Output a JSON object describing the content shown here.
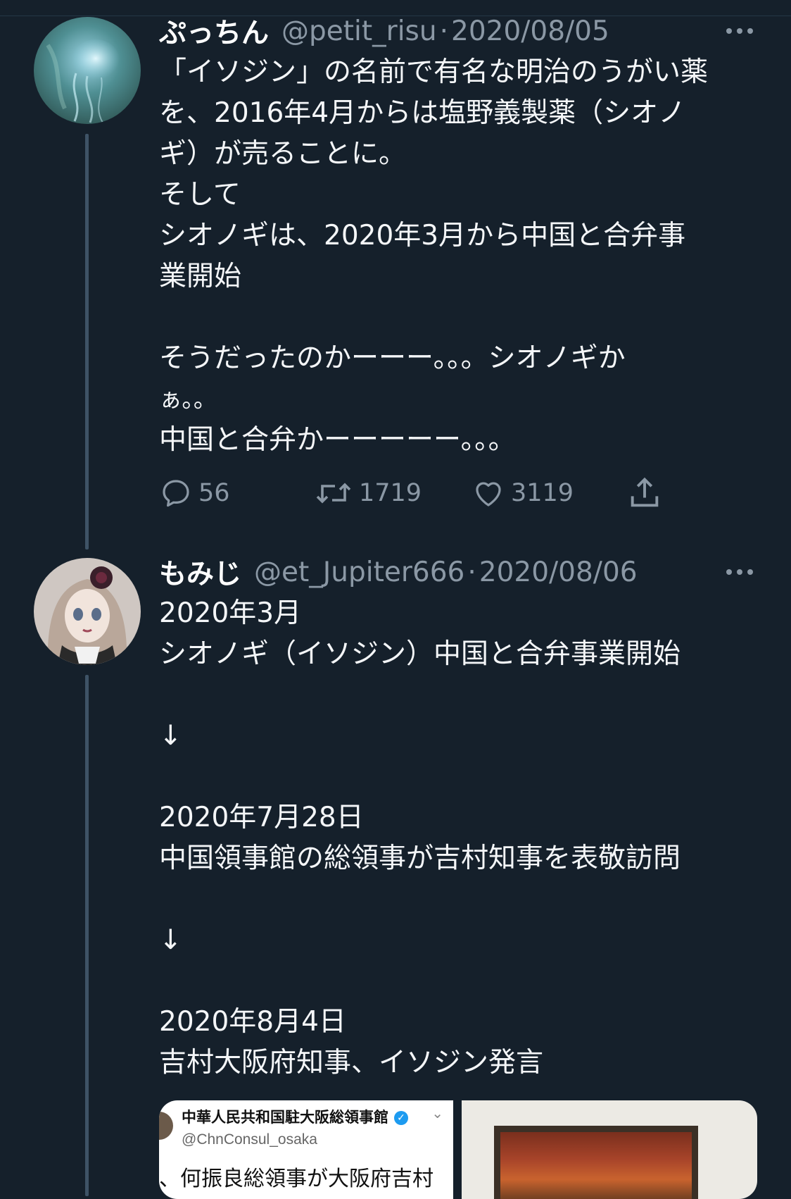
{
  "tweets": [
    {
      "display_name": "ぷっちん",
      "handle": "@petit_risu",
      "separator": "·",
      "date": "2020/08/05",
      "avatar_icon": "jellyfish-avatar-icon",
      "body_lines": [
        "「イソジン」の名前で有名な明治のうがい薬",
        "を、2016年4月からは塩野義製薬（シオノ",
        "ギ）が売ることに。",
        "そして",
        "シオノギは、2020年3月から中国と合弁事",
        "業開始",
        "",
        "そうだったのかーーー。。。シオノギか",
        "ぁ。。",
        "中国と合弁かーーーーー。。。"
      ],
      "actions": {
        "reply_count": "56",
        "retweet_count": "1719",
        "like_count": "3119"
      }
    },
    {
      "display_name": "もみじ",
      "handle": "@et_Jupiter666",
      "separator": "·",
      "date": "2020/08/06",
      "avatar_icon": "doll-avatar-icon",
      "body_lines": [
        "2020年3月",
        "シオノギ（イソジン）中国と合弁事業開始",
        "",
        "↓",
        "",
        "2020年7月28日",
        "中国領事館の総領事が吉村知事を表敬訪問",
        "",
        "↓",
        "",
        "2020年8月4日",
        "吉村大阪府知事、イソジン発言"
      ],
      "media": {
        "embedded_account_name": "中華人民共和国駐大阪総領事館",
        "embedded_handle": "@ChnConsul_osaka",
        "embedded_text": "、何振良総領事が大阪府吉村"
      }
    }
  ],
  "colors": {
    "background": "#15202b",
    "secondary_text": "#8b98a5",
    "thread_line": "#3e5366",
    "verified": "#1d9bf0"
  }
}
